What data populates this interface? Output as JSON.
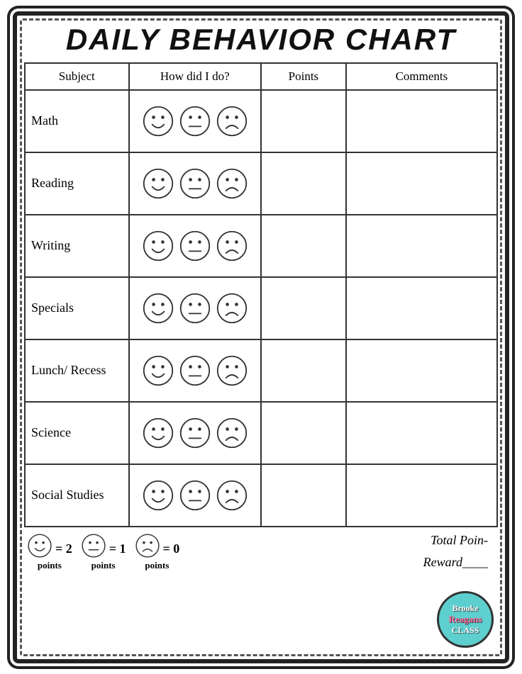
{
  "title": "Daily Behavior Chart",
  "table": {
    "headers": [
      "Subject",
      "How did I do?",
      "Points",
      "Comments"
    ],
    "rows": [
      {
        "subject": "Math"
      },
      {
        "subject": "Reading"
      },
      {
        "subject": "Writing"
      },
      {
        "subject": "Specials"
      },
      {
        "subject": "Lunch/ Recess"
      },
      {
        "subject": "Science"
      },
      {
        "subject": "Social Studies"
      }
    ]
  },
  "legend": [
    {
      "value": "2",
      "label": "points"
    },
    {
      "value": "1",
      "label": "points"
    },
    {
      "value": "0",
      "label": "points"
    }
  ],
  "footer": {
    "total_label": "Total Poin-",
    "reward_label": "Reward____"
  },
  "brand": {
    "line1": "Brooke",
    "line2": "Reagans",
    "line3": "CLASS"
  }
}
